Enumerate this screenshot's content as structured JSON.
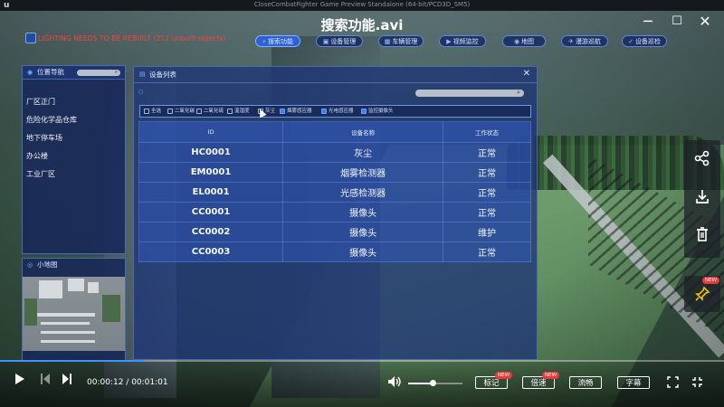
{
  "window": {
    "engine_logo": "u",
    "game_title": "CloseCombatFighter Game Preview Standalone (64-bit/PCD3D_SM5)",
    "video_title": "搜索功能.avi",
    "controls": {
      "minimize": "─",
      "maximize": "☐",
      "close": "✕"
    }
  },
  "warning": "LIGHTING NEEDS TO BE REBUILT (212 unbuilt objects)",
  "nav": [
    {
      "label": "搜索功能",
      "icon": "search-icon",
      "active": true
    },
    {
      "label": "设备管理",
      "icon": "device-icon",
      "active": false
    },
    {
      "label": "车辆管理",
      "icon": "car-icon",
      "active": false
    },
    {
      "label": "视频监控",
      "icon": "camera-icon",
      "active": false
    },
    {
      "label": "地图",
      "icon": "map-icon",
      "active": false
    },
    {
      "label": "漫游巡航",
      "icon": "route-icon",
      "active": false
    },
    {
      "label": "设备巡检",
      "icon": "inspect-icon",
      "active": false
    }
  ],
  "location_panel": {
    "title": "位置导航",
    "items": [
      "厂区正门",
      "危险化学品仓库",
      "地下停车场",
      "办公楼",
      "工业厂区"
    ]
  },
  "minimap": {
    "title": "小地图"
  },
  "device_list": {
    "title": "设备列表",
    "close": "✕",
    "filters": [
      {
        "label": "全选",
        "checked": false
      },
      {
        "label": "二氧化碳",
        "checked": false
      },
      {
        "label": "二氧化硫",
        "checked": false
      },
      {
        "label": "温湿度",
        "checked": false
      },
      {
        "label": "灰尘",
        "checked": false
      },
      {
        "label": "烟雾感应器",
        "checked": true
      },
      {
        "label": "光电感应器",
        "checked": true
      },
      {
        "label": "监控摄像头",
        "checked": true
      }
    ],
    "columns": [
      "ID",
      "设备名称",
      "工作状态"
    ],
    "rows": [
      [
        "HC0001",
        "灰尘",
        "正常"
      ],
      [
        "EM0001",
        "烟雾检测器",
        "正常"
      ],
      [
        "EL0001",
        "光感检测器",
        "正常"
      ],
      [
        "CC0001",
        "摄像头",
        "正常"
      ],
      [
        "CC0002",
        "摄像头",
        "维护"
      ],
      [
        "CC0003",
        "摄像头",
        "正常"
      ]
    ]
  },
  "side_tools": [
    {
      "icon": "share-icon",
      "glyph": "⋰"
    },
    {
      "icon": "download-icon",
      "glyph": "⤓"
    },
    {
      "icon": "trash-icon",
      "glyph": "🗑"
    }
  ],
  "pin": {
    "icon": "pin-icon",
    "badge": "NEW"
  },
  "player": {
    "current_time": "00:00:12",
    "separator": " / ",
    "total_time": "00:01:01",
    "progress": 0.2,
    "volume": 0.45,
    "buttons": [
      {
        "label": "标记",
        "badge": "NEW"
      },
      {
        "label": "倍速",
        "badge": "NEW"
      },
      {
        "label": "流畅",
        "badge": ""
      },
      {
        "label": "字幕",
        "badge": ""
      }
    ]
  }
}
